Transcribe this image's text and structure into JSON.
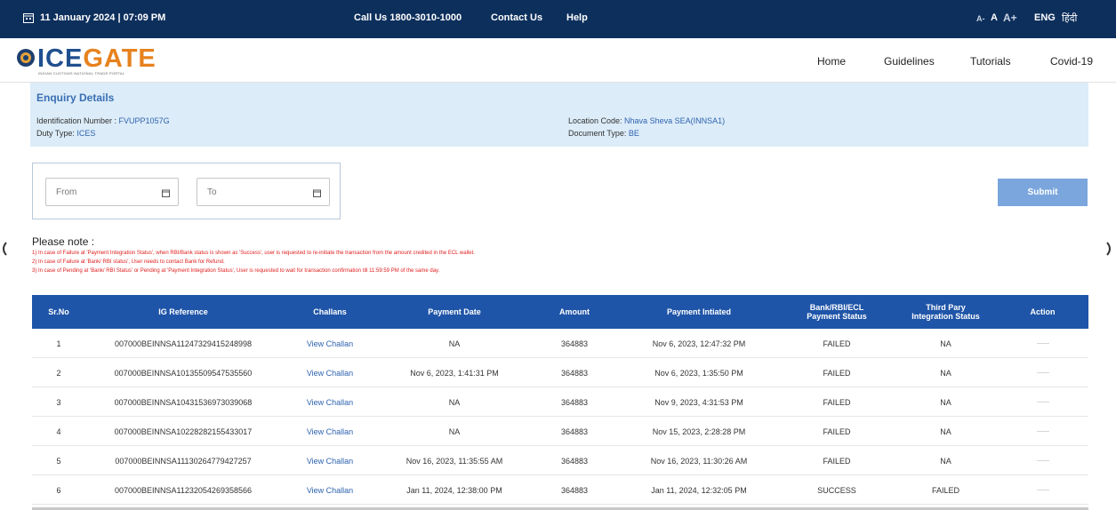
{
  "topbar": {
    "date_time": "11 January 2024 | 07:09 PM",
    "call_us": "Call Us  1800-3010-1000",
    "contact_us": "Contact Us",
    "help": "Help",
    "font_small": "A-",
    "font_normal": "A",
    "font_large": "A+",
    "lang_en": "ENG",
    "lang_hi": "हिंदी"
  },
  "logo": {
    "word_a": "ICE",
    "word_b": "GATE",
    "tagline": "INDIAN CUSTOMS NATIONAL TRADE PORTAL"
  },
  "nav": [
    "Home",
    "Guidelines",
    "Tutorials",
    "Covid-19"
  ],
  "enquiry": {
    "title": "Enquiry Details",
    "id_label": "Identification Number : ",
    "id_value": "FVUPP1057G",
    "duty_label": "Duty Type: ",
    "duty_value": "ICES",
    "loc_label": "Location Code: ",
    "loc_value": "Nhava Sheva SEA(INNSA1)",
    "doc_label": "Document Type: ",
    "doc_value": "BE"
  },
  "filters": {
    "from_placeholder": "From",
    "to_placeholder": "To",
    "submit_label": "Submit"
  },
  "notes": {
    "title": "Please note :",
    "lines": [
      "1) In case of Failure at 'Payment Integration Status', when RBI/Bank status is shown as 'Success', user is requested to re-initiate the transaction from the amount credited in the ECL wallet.",
      "2) In case of Failure at 'Bank/ RBI status', User needs to contact Bank for Refund.",
      "3) In case of Pending at 'Bank/ RBI Status' or Pending at 'Payment Integration Status', User is requested to wait for transaction confirmation till 11:59:59 PM of the same day."
    ]
  },
  "table": {
    "headers": {
      "srno": "Sr.No",
      "igref": "IG Reference",
      "challans": "Challans",
      "paydate": "Payment Date",
      "amount": "Amount",
      "initiated": "Payment Intiated",
      "bank1": "Bank/RBI/ECL",
      "bank2": "Payment Status",
      "third1": "Third Pary",
      "third2": "Integration Status",
      "action": "Action"
    },
    "rows": [
      {
        "sr": "1",
        "ig": "007000BEINNSA11247329415248998",
        "challan": "View Challan",
        "paydate": "NA",
        "amount": "364883",
        "initiated": "Nov 6, 2023, 12:47:32 PM",
        "bank": "FAILED",
        "third": "NA"
      },
      {
        "sr": "2",
        "ig": "007000BEINNSA10135509547535560",
        "challan": "View Challan",
        "paydate": "Nov 6, 2023, 1:41:31 PM",
        "amount": "364883",
        "initiated": "Nov 6, 2023, 1:35:50 PM",
        "bank": "FAILED",
        "third": "NA"
      },
      {
        "sr": "3",
        "ig": "007000BEINNSA10431536973039068",
        "challan": "View Challan",
        "paydate": "NA",
        "amount": "364883",
        "initiated": "Nov 9, 2023, 4:31:53 PM",
        "bank": "FAILED",
        "third": "NA"
      },
      {
        "sr": "4",
        "ig": "007000BEINNSA10228282155433017",
        "challan": "View Challan",
        "paydate": "NA",
        "amount": "364883",
        "initiated": "Nov 15, 2023, 2:28:28 PM",
        "bank": "FAILED",
        "third": "NA"
      },
      {
        "sr": "5",
        "ig": "007000BEINNSA11130264779427257",
        "challan": "View Challan",
        "paydate": "Nov 16, 2023, 11:35:55 AM",
        "amount": "364883",
        "initiated": "Nov 16, 2023, 11:30:26 AM",
        "bank": "FAILED",
        "third": "NA"
      },
      {
        "sr": "6",
        "ig": "007000BEINNSA11232054269358566",
        "challan": "View Challan",
        "paydate": "Jan 11, 2024, 12:38:00 PM",
        "amount": "364883",
        "initiated": "Jan 11, 2024, 12:32:05 PM",
        "bank": "SUCCESS",
        "third": "FAILED"
      }
    ]
  },
  "colors": {
    "topbar": "#0d2f5c",
    "table_header": "#1f55a8",
    "enquiry_bg": "#dcecf8",
    "submit": "#7aa6dd",
    "note_text": "#e02020",
    "link": "#2f63b0"
  },
  "icons": [
    "calendar-icon",
    "emblem-icon",
    "calendar-input-icon",
    "scroll-left-icon",
    "scroll-right-icon"
  ]
}
